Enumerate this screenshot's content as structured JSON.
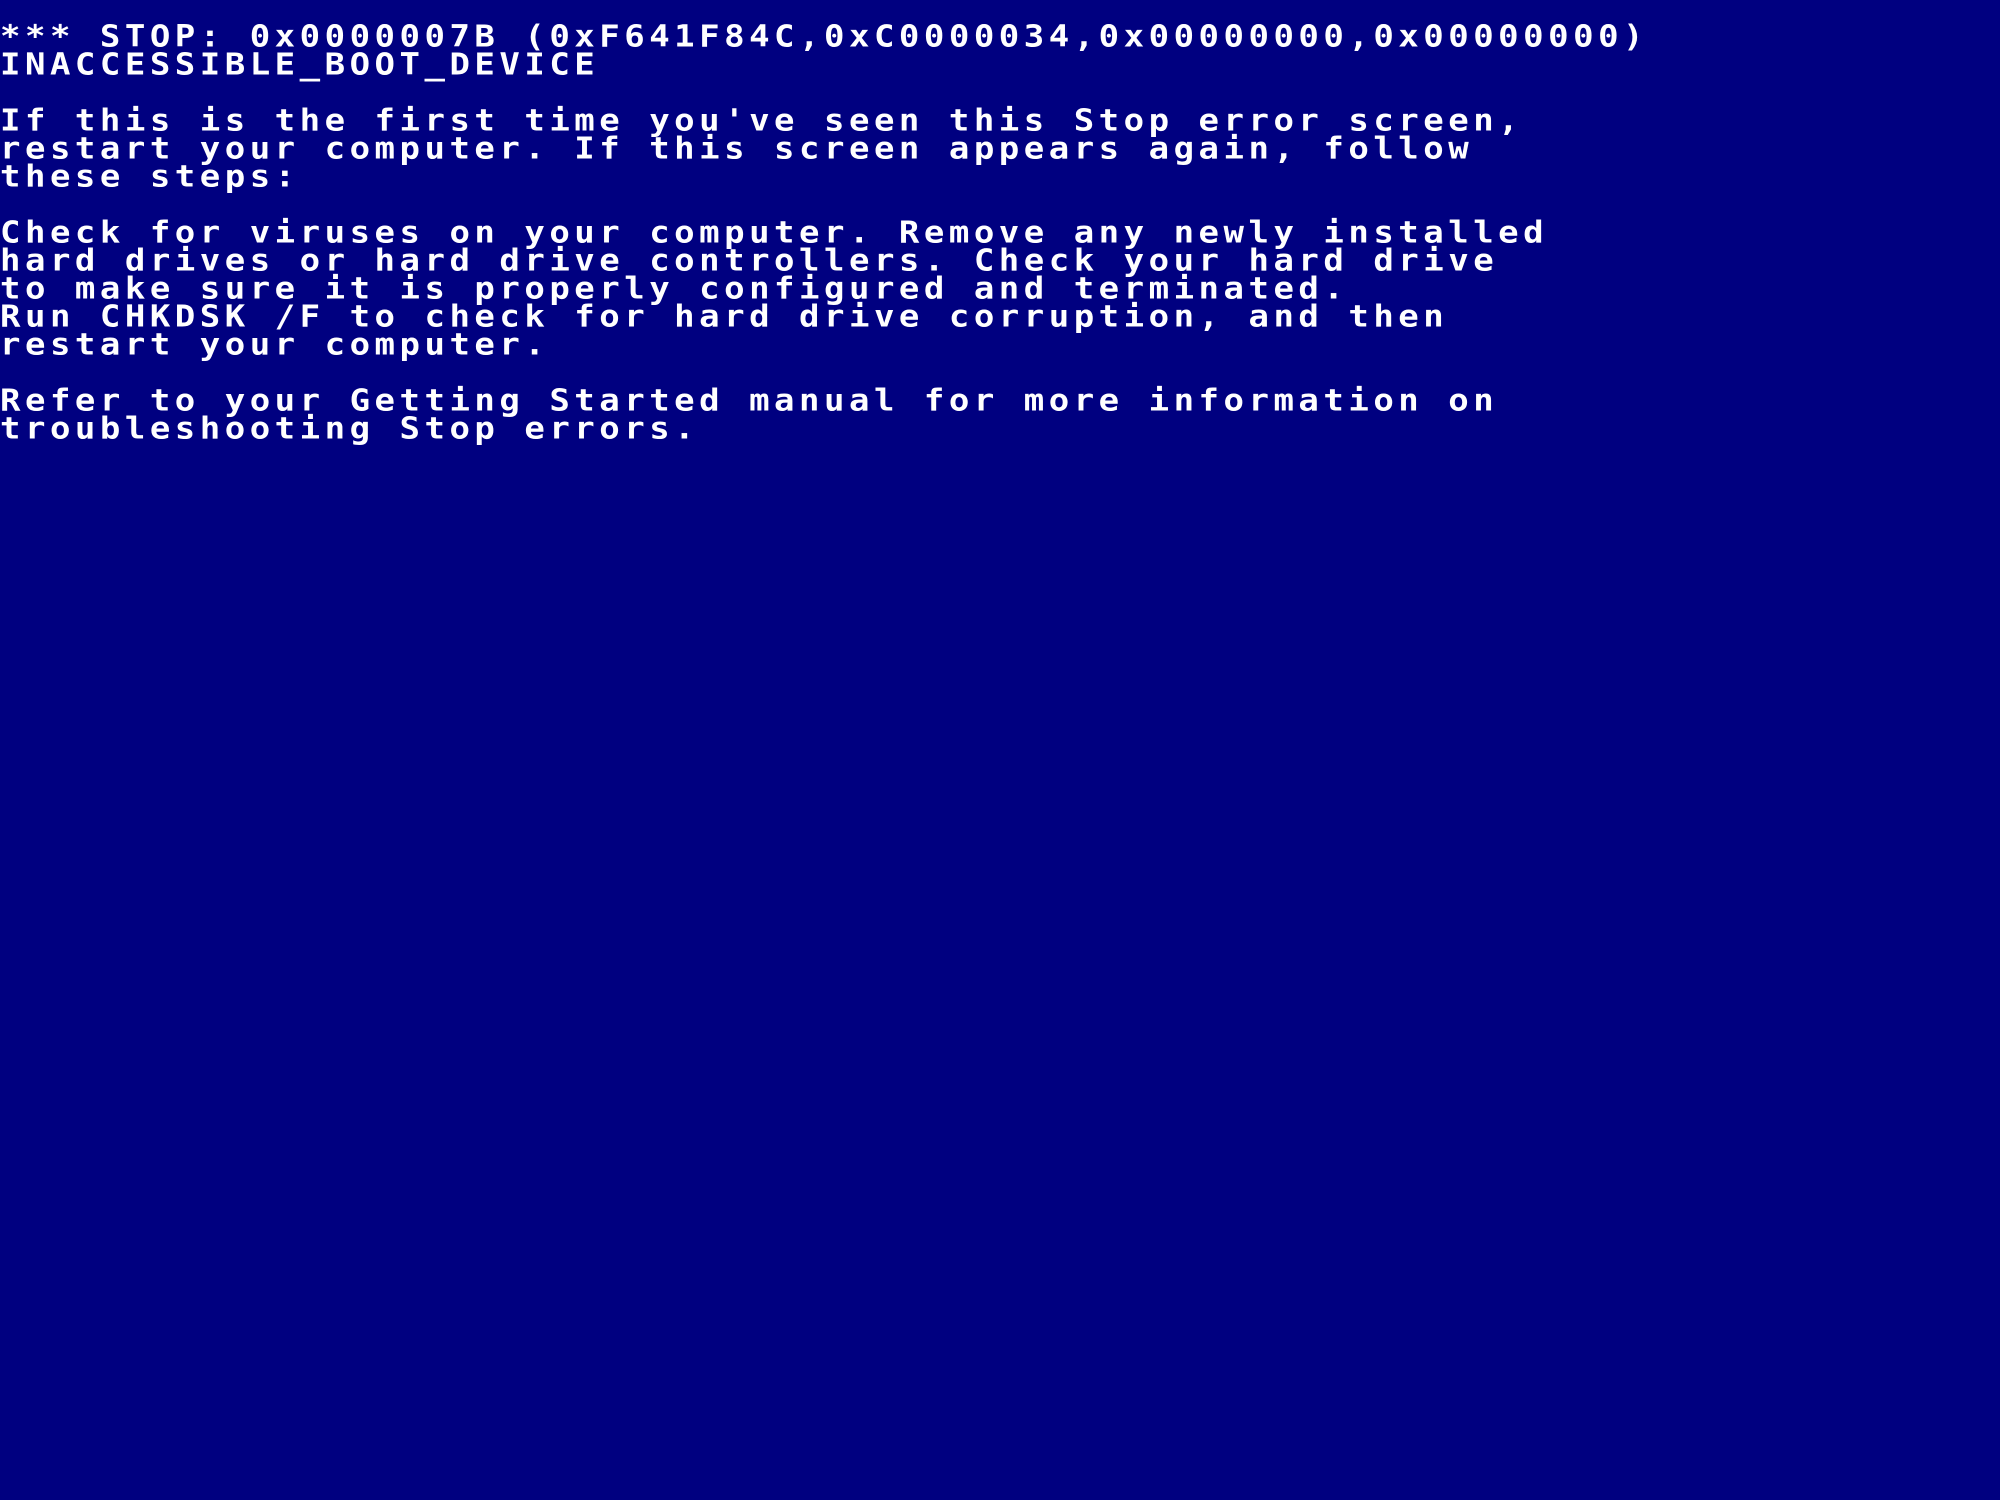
{
  "colors": {
    "background": "#000080",
    "text": "#ffffff"
  },
  "stop_code": {
    "line": "*** STOP: 0x0000007B (0xF641F84C,0xC0000034,0x00000000,0x00000000)",
    "name": "INACCESSIBLE_BOOT_DEVICE"
  },
  "paragraphs": [
    {
      "lines": [
        "If this is the first time you've seen this Stop error screen,",
        "restart your computer. If this screen appears again, follow",
        "these steps:"
      ]
    },
    {
      "lines": [
        "Check for viruses on your computer. Remove any newly installed",
        "hard drives or hard drive controllers. Check your hard drive",
        "to make sure it is properly configured and terminated.",
        "Run CHKDSK /F to check for hard drive corruption, and then",
        "restart your computer."
      ]
    },
    {
      "lines": [
        "Refer to your Getting Started manual for more information on",
        "troubleshooting Stop errors."
      ]
    }
  ]
}
